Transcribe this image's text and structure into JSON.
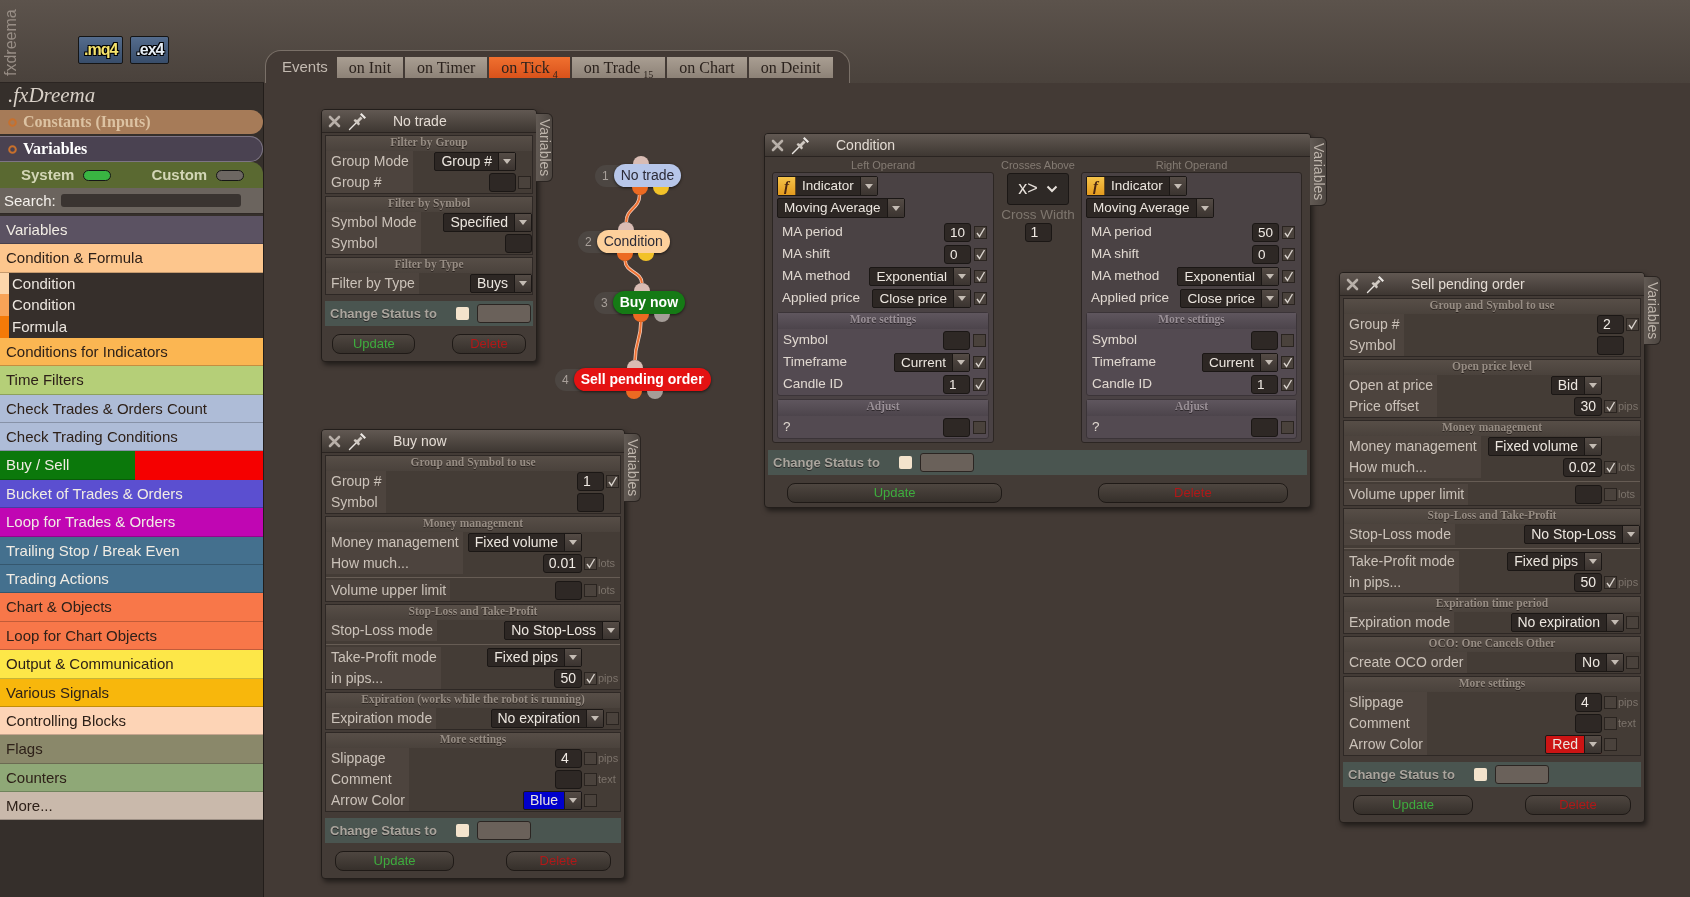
{
  "header": {
    "vertical_label": "fxdreema",
    "file_buttons": [
      ".mq4",
      ".ex4"
    ]
  },
  "events": {
    "label": "Events",
    "tabs": [
      {
        "label": "on Init",
        "selected": false
      },
      {
        "label": "on Timer",
        "selected": false
      },
      {
        "label": "on Tick",
        "count": "4",
        "selected": true
      },
      {
        "label": "on Trade",
        "count": "15",
        "selected": false
      },
      {
        "label": "on Chart",
        "selected": false
      },
      {
        "label": "on Deinit",
        "selected": false
      }
    ]
  },
  "sidebar": {
    "logo": ".fxDreema",
    "sections": [
      {
        "label": "Constants (Inputs)",
        "color": "#a67b58",
        "selected": false
      },
      {
        "label": "Variables",
        "color": "#4a4251",
        "selected": true
      }
    ],
    "toggles": [
      {
        "label": "System",
        "on": true
      },
      {
        "label": "Custom",
        "on": false
      }
    ],
    "search": {
      "label": "Search:"
    },
    "categories": [
      {
        "label": "Variables",
        "color": "#5b5262"
      },
      {
        "label": "Condition & Formula",
        "color": "#fdc68d",
        "expanded": true,
        "children": [
          {
            "label": "Condition",
            "color": "#fdd6ab"
          },
          {
            "label": "Condition",
            "color": "#f8a357"
          },
          {
            "label": "Formula",
            "color": "#f47a08"
          }
        ]
      },
      {
        "label": "Conditions for Indicators",
        "color": "#fbb652"
      },
      {
        "label": "Time Filters",
        "color": "#b5cf78"
      },
      {
        "label": "Check Trades & Orders Count",
        "color": "#aebcd7"
      },
      {
        "label": "Check Trading Conditions",
        "color": "#aebcd7"
      },
      {
        "label": "Buy / Sell",
        "color": "#0b780b",
        "band": {
          "color": "#f50000"
        }
      },
      {
        "label": "Bucket of Trades & Orders",
        "color": "#5b4fd0"
      },
      {
        "label": "Loop for Trades & Orders",
        "color": "#c006b3"
      },
      {
        "label": "Trailing Stop / Break Even",
        "color": "#44708e"
      },
      {
        "label": "Trading Actions",
        "color": "#44708e"
      },
      {
        "label": "Chart & Objects",
        "color": "#f87749"
      },
      {
        "label": "Loop for Chart Objects",
        "color": "#f87749"
      },
      {
        "label": "Output & Communication",
        "color": "#fde748"
      },
      {
        "label": "Various Signals",
        "color": "#f8b70c"
      },
      {
        "label": "Controlling Blocks",
        "color": "#fdd4b6"
      },
      {
        "label": "Flags",
        "color": "#8a886a"
      },
      {
        "label": "Counters",
        "color": "#8fa877"
      },
      {
        "label": "More...",
        "color": "#c9b9ab"
      }
    ]
  },
  "diagram": {
    "nodes": [
      {
        "number": "1",
        "label": "No trade",
        "color": "#b7c6e9",
        "kind": "condition",
        "children": [
          {
            "number": "2",
            "label": "Condition",
            "color": "#fdd09b",
            "kind": "condition",
            "children": [
              {
                "number": "3",
                "label": "Buy now",
                "color": "#157a15",
                "kind": "action",
                "children": [
                  {
                    "number": "4",
                    "label": "Sell pending order",
                    "color": "#e41212",
                    "kind": "action"
                  }
                ]
              }
            ]
          }
        ]
      }
    ]
  },
  "panels": [
    {
      "kind": "block",
      "title": "No trade",
      "side_tab": "Variables",
      "sections": [
        {
          "title": "Filter by Group",
          "groups": [
            {
              "rows": [
                {
                  "kind": "select",
                  "label": "Group Mode",
                  "value": "Group #"
                },
                {
                  "kind": "input",
                  "label": "Group #",
                  "checked": false
                }
              ]
            }
          ]
        },
        {
          "title": "Filter by Symbol",
          "groups": [
            {
              "rows": [
                {
                  "kind": "select",
                  "label": "Symbol Mode",
                  "value": "Specified"
                },
                {
                  "kind": "input",
                  "label": "Symbol"
                }
              ]
            }
          ]
        },
        {
          "title": "Filter by Type",
          "groups": [
            {
              "rows": [
                {
                  "kind": "select",
                  "label": "Filter by Type",
                  "value": "Buys"
                }
              ]
            }
          ]
        }
      ],
      "change_status": {
        "label": "Change Status to",
        "checked": false
      },
      "buttons": [
        {
          "kind": "update",
          "label": "Update"
        },
        {
          "kind": "delete",
          "label": "Delete"
        }
      ]
    },
    {
      "kind": "block",
      "title": "Buy now",
      "side_tab": "Variables",
      "sections": [
        {
          "title": "Group and Symbol to use",
          "groups": [
            {
              "rows": [
                {
                  "kind": "input",
                  "label": "Group #",
                  "value": "1",
                  "checked": true
                },
                {
                  "kind": "input",
                  "label": "Symbol"
                }
              ]
            }
          ]
        },
        {
          "title": "Money management",
          "groups": [
            {
              "rows": [
                {
                  "kind": "select",
                  "label": "Money management",
                  "value": "Fixed volume"
                },
                {
                  "kind": "input",
                  "label": "How much...",
                  "value": "0.01",
                  "checked": true,
                  "unit": "lots"
                }
              ]
            },
            {
              "rows": [
                {
                  "kind": "input",
                  "label": "Volume upper limit",
                  "checked": false,
                  "unit": "lots"
                }
              ]
            }
          ]
        },
        {
          "title": "Stop-Loss and Take-Profit",
          "groups": [
            {
              "rows": [
                {
                  "kind": "select",
                  "label": "Stop-Loss mode",
                  "value": "No Stop-Loss"
                }
              ]
            },
            {
              "rows": [
                {
                  "kind": "select",
                  "label": "Take-Profit mode",
                  "value": "Fixed pips"
                },
                {
                  "kind": "input",
                  "label": "in pips...",
                  "value": "50",
                  "checked": true,
                  "unit": "pips"
                }
              ]
            }
          ]
        },
        {
          "title": "Expiration (works while the robot is running)",
          "groups": [
            {
              "rows": [
                {
                  "kind": "select",
                  "label": "Expiration mode",
                  "value": "No expiration",
                  "checked": false
                }
              ]
            }
          ]
        },
        {
          "title": "More settings",
          "groups": [
            {
              "rows": [
                {
                  "kind": "input",
                  "label": "Slippage",
                  "value": "4",
                  "checked": false,
                  "unit": "pips"
                },
                {
                  "kind": "input",
                  "label": "Comment",
                  "checked": false,
                  "unit": "text"
                },
                {
                  "kind": "select",
                  "label": "Arrow Color",
                  "value": "Blue",
                  "color": "#0000cc",
                  "checked": false
                }
              ]
            }
          ]
        }
      ],
      "change_status": {
        "label": "Change Status to",
        "checked": false
      },
      "buttons": [
        {
          "kind": "update",
          "label": "Update"
        },
        {
          "kind": "delete",
          "label": "Delete"
        }
      ]
    },
    {
      "kind": "condition",
      "title": "Condition",
      "side_tab": "Variables",
      "left_operand": {
        "heading": "Left Operand",
        "source_icon": "f",
        "source": "Indicator",
        "indicator": "Moving Average",
        "rows": [
          {
            "kind": "input",
            "label": "MA period",
            "value": "10",
            "checked": true
          },
          {
            "kind": "input",
            "label": "MA shift",
            "value": "0",
            "checked": true
          },
          {
            "kind": "select",
            "label": "MA method",
            "value": "Exponential",
            "checked": true
          },
          {
            "kind": "select",
            "label": "Applied price",
            "value": "Close price",
            "checked": true
          }
        ],
        "sections": [
          {
            "title": "More settings",
            "rows": [
              {
                "kind": "input",
                "label": "Symbol",
                "checked": false
              },
              {
                "kind": "select",
                "label": "Timeframe",
                "value": "Current",
                "checked": true
              },
              {
                "kind": "input",
                "label": "Candle ID",
                "value": "1",
                "checked": true
              }
            ]
          },
          {
            "title": "Adjust",
            "rows": [
              {
                "kind": "input",
                "label": "?",
                "checked": false
              }
            ]
          }
        ]
      },
      "operator": {
        "heading": "Crosses Above",
        "value": "x>",
        "width_label": "Cross Width",
        "width_value": "1"
      },
      "right_operand": {
        "heading": "Right Operand",
        "source_icon": "f",
        "source": "Indicator",
        "indicator": "Moving Average",
        "rows": [
          {
            "kind": "input",
            "label": "MA period",
            "value": "50",
            "checked": true
          },
          {
            "kind": "input",
            "label": "MA shift",
            "value": "0",
            "checked": true
          },
          {
            "kind": "select",
            "label": "MA method",
            "value": "Exponential",
            "checked": true
          },
          {
            "kind": "select",
            "label": "Applied price",
            "value": "Close price",
            "checked": true
          }
        ],
        "sections": [
          {
            "title": "More settings",
            "rows": [
              {
                "kind": "input",
                "label": "Symbol",
                "checked": false
              },
              {
                "kind": "select",
                "label": "Timeframe",
                "value": "Current",
                "checked": true
              },
              {
                "kind": "input",
                "label": "Candle ID",
                "value": "1",
                "checked": true
              }
            ]
          },
          {
            "title": "Adjust",
            "rows": [
              {
                "kind": "input",
                "label": "?",
                "checked": false
              }
            ]
          }
        ]
      },
      "change_status": {
        "label": "Change Status to",
        "checked": false
      },
      "buttons": [
        {
          "kind": "update",
          "label": "Update"
        },
        {
          "kind": "delete",
          "label": "Delete"
        }
      ]
    },
    {
      "kind": "block",
      "title": "Sell pending order",
      "side_tab": "Variables",
      "sections": [
        {
          "title": "Group and Symbol to use",
          "groups": [
            {
              "rows": [
                {
                  "kind": "input",
                  "label": "Group #",
                  "value": "2",
                  "checked": true
                },
                {
                  "kind": "input",
                  "label": "Symbol"
                }
              ]
            }
          ]
        },
        {
          "title": "Open price level",
          "groups": [
            {
              "rows": [
                {
                  "kind": "select",
                  "label": "Open at price",
                  "value": "Bid"
                },
                {
                  "kind": "input",
                  "label": "Price offset",
                  "value": "30",
                  "checked": true,
                  "unit": "pips"
                }
              ]
            }
          ]
        },
        {
          "title": "Money management",
          "groups": [
            {
              "rows": [
                {
                  "kind": "select",
                  "label": "Money management",
                  "value": "Fixed volume"
                },
                {
                  "kind": "input",
                  "label": "How much...",
                  "value": "0.02",
                  "checked": true,
                  "unit": "lots"
                }
              ]
            },
            {
              "rows": [
                {
                  "kind": "input",
                  "label": "Volume upper limit",
                  "checked": false,
                  "unit": "lots"
                }
              ]
            }
          ]
        },
        {
          "title": "Stop-Loss and Take-Profit",
          "groups": [
            {
              "rows": [
                {
                  "kind": "select",
                  "label": "Stop-Loss mode",
                  "value": "No Stop-Loss"
                }
              ]
            },
            {
              "rows": [
                {
                  "kind": "select",
                  "label": "Take-Profit mode",
                  "value": "Fixed pips"
                },
                {
                  "kind": "input",
                  "label": "in pips...",
                  "value": "50",
                  "checked": true,
                  "unit": "pips"
                }
              ]
            }
          ]
        },
        {
          "title": "Expiration time period",
          "groups": [
            {
              "rows": [
                {
                  "kind": "select",
                  "label": "Expiration mode",
                  "value": "No expiration",
                  "checked": false
                }
              ]
            }
          ]
        },
        {
          "title": "OCO: One Cancels Other",
          "groups": [
            {
              "rows": [
                {
                  "kind": "select",
                  "label": "Create OCO order",
                  "value": "No",
                  "checked": false
                }
              ]
            }
          ]
        },
        {
          "title": "More settings",
          "groups": [
            {
              "rows": [
                {
                  "kind": "input",
                  "label": "Slippage",
                  "value": "4",
                  "checked": false,
                  "unit": "pips"
                },
                {
                  "kind": "input",
                  "label": "Comment",
                  "checked": false,
                  "unit": "text"
                },
                {
                  "kind": "select",
                  "label": "Arrow Color",
                  "value": "Red",
                  "color": "#cc1414",
                  "checked": false
                }
              ]
            }
          ]
        }
      ],
      "change_status": {
        "label": "Change Status to",
        "checked": false
      },
      "buttons": [
        {
          "kind": "update",
          "label": "Update"
        },
        {
          "kind": "delete",
          "label": "Delete"
        }
      ]
    }
  ]
}
